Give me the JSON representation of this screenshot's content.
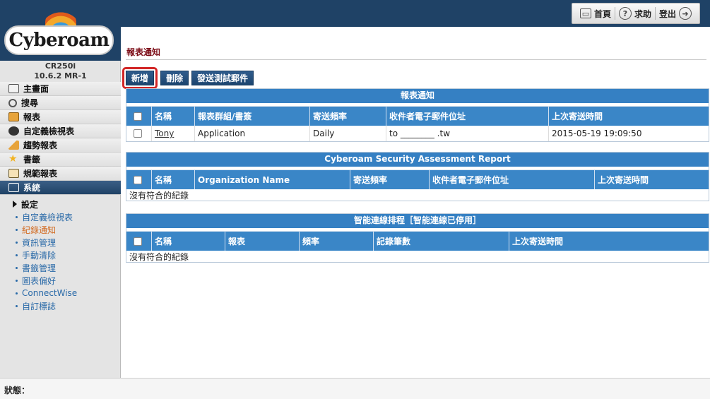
{
  "header": {
    "links": [
      {
        "label": "首頁",
        "icon": "home-icon"
      },
      {
        "label": "求助",
        "icon": "help-icon"
      },
      {
        "label": "登出",
        "icon": "logout-icon"
      }
    ]
  },
  "brand": {
    "logo_text": "Cyberoam",
    "model": "CR250i",
    "version": "10.6.2 MR-1"
  },
  "sidebar": {
    "items": [
      {
        "label": "主畫面",
        "icon": "dashboard-icon"
      },
      {
        "label": "搜尋",
        "icon": "search-icon"
      },
      {
        "label": "報表",
        "icon": "reports-icon"
      },
      {
        "label": "自定義檢視表",
        "icon": "eye-icon"
      },
      {
        "label": "趨勢報表",
        "icon": "trend-chart-icon"
      },
      {
        "label": "書籤",
        "icon": "star-icon"
      },
      {
        "label": "規範報表",
        "icon": "compliance-icon"
      },
      {
        "label": "系統",
        "icon": "monitor-icon"
      }
    ],
    "submenu_title": "設定",
    "submenu": [
      "自定義檢視表",
      "紀錄通知",
      "資訊管理",
      "手動清除",
      "書籤管理",
      "圖表偏好",
      "ConnectWise",
      "自訂標誌"
    ]
  },
  "page": {
    "title": "報表通知",
    "buttons": {
      "add": "新增",
      "delete": "刪除",
      "send_test": "發送測試郵件"
    }
  },
  "section1": {
    "title": "報表通知",
    "columns": [
      "名稱",
      "報表群組/書簽",
      "寄送頻率",
      "收件者電子郵件位址",
      "上次寄送時間"
    ],
    "rows": [
      {
        "name": "Tony",
        "group": "Application",
        "frequency": "Daily",
        "email": "to ________ .tw",
        "last_sent": "2015-05-19 19:09:50"
      }
    ]
  },
  "section2": {
    "title": "Cyberoam Security Assessment Report",
    "columns": [
      "名稱",
      "Organization Name",
      "寄送頻率",
      "收件者電子郵件位址",
      "上次寄送時間"
    ],
    "empty": "沒有符合的紀錄"
  },
  "section3": {
    "title": "智能連線排程［智能連線已停用］",
    "columns": [
      "名稱",
      "報表",
      "頻率",
      "記錄筆數",
      "上次寄送時間"
    ],
    "empty": "沒有符合的紀錄"
  },
  "status": {
    "label": "狀態："
  },
  "colors": {
    "header_bg": "#1f4266",
    "table_header": "#3a86c7",
    "title_red": "#7a0a14",
    "highlight": "#d22525"
  }
}
